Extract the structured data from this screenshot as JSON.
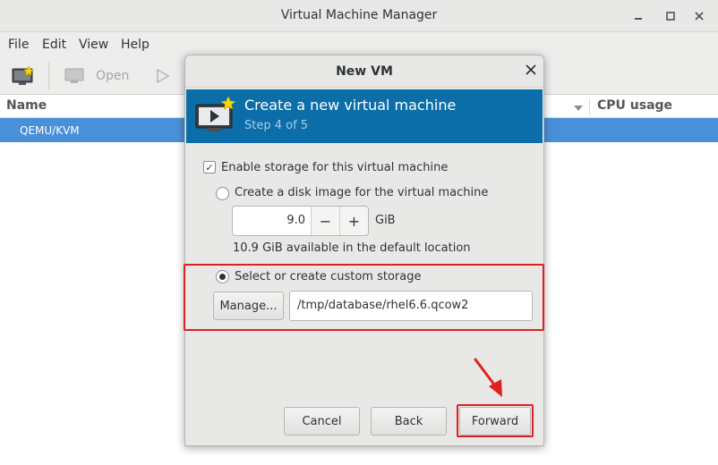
{
  "window": {
    "title": "Virtual Machine Manager"
  },
  "menu": {
    "items": [
      "File",
      "Edit",
      "View",
      "Help"
    ]
  },
  "toolbar": {
    "open_label": "Open"
  },
  "list": {
    "col_name": "Name",
    "col_cpu": "CPU usage",
    "row_label": "QEMU/KVM"
  },
  "dialog": {
    "title": "New VM",
    "heading": "Create a new virtual machine",
    "step": "Step 4 of 5",
    "enable_storage_label": "Enable storage for this virtual machine",
    "create_disk_label": "Create a disk image for the virtual machine",
    "disk_size": "9.0",
    "disk_unit": "GiB",
    "available_text": "10.9 GiB available in the default location",
    "custom_storage_label": "Select or create custom storage",
    "manage_label": "Manage...",
    "storage_path": "/tmp/database/rhel6.6.qcow2",
    "cancel_label": "Cancel",
    "back_label": "Back",
    "forward_label": "Forward",
    "minus_symbol": "−",
    "plus_symbol": "+"
  },
  "colors": {
    "header_blue": "#0c6ea8",
    "selection_blue": "#4a90d9",
    "highlight_red": "#e02020"
  }
}
